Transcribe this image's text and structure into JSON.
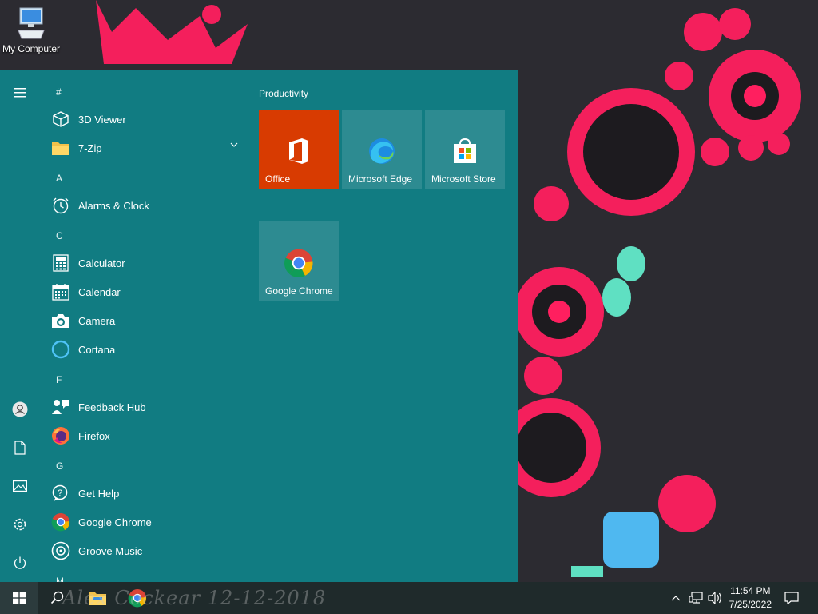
{
  "desktop": {
    "icon_label": "My Computer",
    "icon": "computer-icon"
  },
  "start_menu": {
    "rail": [
      "hamburger-icon",
      "user-icon",
      "document-icon",
      "pictures-icon",
      "settings-icon",
      "power-icon"
    ],
    "app_list": [
      {
        "type": "header",
        "label": "#"
      },
      {
        "type": "app",
        "label": "3D Viewer",
        "icon": "cube-icon"
      },
      {
        "type": "app",
        "label": "7-Zip",
        "icon": "folder-icon",
        "expandable": true
      },
      {
        "type": "header",
        "label": "A"
      },
      {
        "type": "app",
        "label": "Alarms & Clock",
        "icon": "clock-icon"
      },
      {
        "type": "header",
        "label": "C"
      },
      {
        "type": "app",
        "label": "Calculator",
        "icon": "calculator-icon"
      },
      {
        "type": "app",
        "label": "Calendar",
        "icon": "calendar-icon"
      },
      {
        "type": "app",
        "label": "Camera",
        "icon": "camera-icon"
      },
      {
        "type": "app",
        "label": "Cortana",
        "icon": "cortana-icon"
      },
      {
        "type": "header",
        "label": "F"
      },
      {
        "type": "app",
        "label": "Feedback Hub",
        "icon": "feedback-icon"
      },
      {
        "type": "app",
        "label": "Firefox",
        "icon": "firefox-icon"
      },
      {
        "type": "header",
        "label": "G"
      },
      {
        "type": "app",
        "label": "Get Help",
        "icon": "help-icon"
      },
      {
        "type": "app",
        "label": "Google Chrome",
        "icon": "chrome-icon"
      },
      {
        "type": "app",
        "label": "Groove Music",
        "icon": "groove-icon"
      },
      {
        "type": "header",
        "label": "M"
      }
    ],
    "tile_group": "Productivity",
    "tiles": [
      {
        "label": "Office",
        "icon": "office-icon",
        "color": "#d83b01"
      },
      {
        "label": "Microsoft Edge",
        "icon": "edge-icon"
      },
      {
        "label": "Microsoft Store",
        "icon": "store-icon"
      },
      {
        "label": "Google Chrome",
        "icon": "chrome-icon"
      }
    ]
  },
  "taskbar": {
    "buttons": [
      "windows-start-icon",
      "search-icon",
      "file-explorer-icon",
      "chrome-icon"
    ],
    "tray_icons": [
      "chevron-up-icon",
      "network-icon",
      "volume-icon"
    ],
    "time": "11:54 PM",
    "date": "7/25/2022",
    "action_center": "notification-icon"
  },
  "colors": {
    "start_bg": "#117c82",
    "taskbar_bg": "#1f2a2b",
    "office_tile": "#d83b01",
    "wallpaper_accent": "#ff1f5f"
  },
  "watermark": "Alex Cockear 12-12-2018"
}
